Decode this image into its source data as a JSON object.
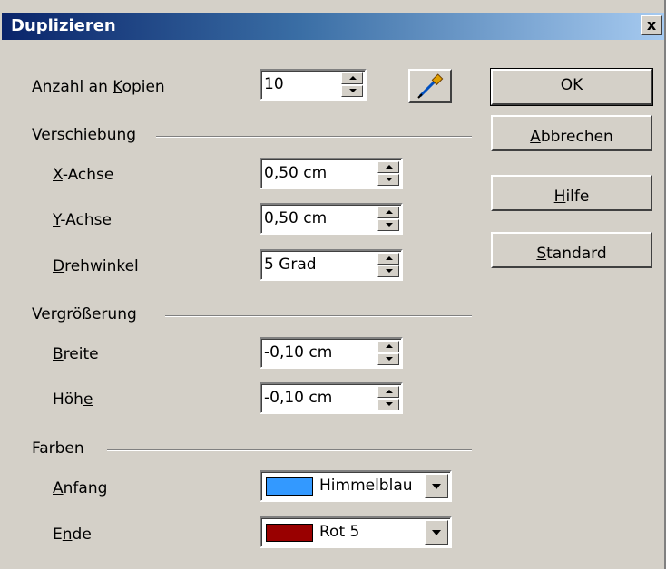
{
  "dialog": {
    "title": "Duplizieren",
    "close_label": "x"
  },
  "copies": {
    "label_pre": "Anzahl an ",
    "label_mn": "K",
    "label_post": "opien",
    "value": "10"
  },
  "shift": {
    "heading": "Verschiebung",
    "x": {
      "label_mn": "X",
      "label_post": "-Achse",
      "value": "0,50 cm"
    },
    "y": {
      "label_mn": "Y",
      "label_post": "-Achse",
      "value": "0,50 cm"
    },
    "angle": {
      "label_mn": "D",
      "label_post": "rehwinkel",
      "value": "5 Grad"
    }
  },
  "enlarge": {
    "heading": "Vergrößerung",
    "width": {
      "label_mn": "B",
      "label_post": "reite",
      "value": "-0,10 cm"
    },
    "height": {
      "label_pre": "Höh",
      "label_mn": "e",
      "value": "-0,10 cm"
    }
  },
  "colors": {
    "heading": "Farben",
    "start": {
      "label_mn": "A",
      "label_post": "nfang",
      "value": "Himmelblau",
      "swatch": "#3399ff"
    },
    "end": {
      "label_pre": "E",
      "label_mn": "n",
      "label_post": "de",
      "value": "Rot 5",
      "swatch": "#990000"
    }
  },
  "buttons": {
    "ok": "OK",
    "cancel_mn": "A",
    "cancel_post": "bbrechen",
    "help_mn": "H",
    "help_post": "ilfe",
    "default_mn": "S",
    "default_post": "tandard"
  },
  "icons": {
    "pipette": "pipette-icon",
    "close": "close-icon"
  }
}
